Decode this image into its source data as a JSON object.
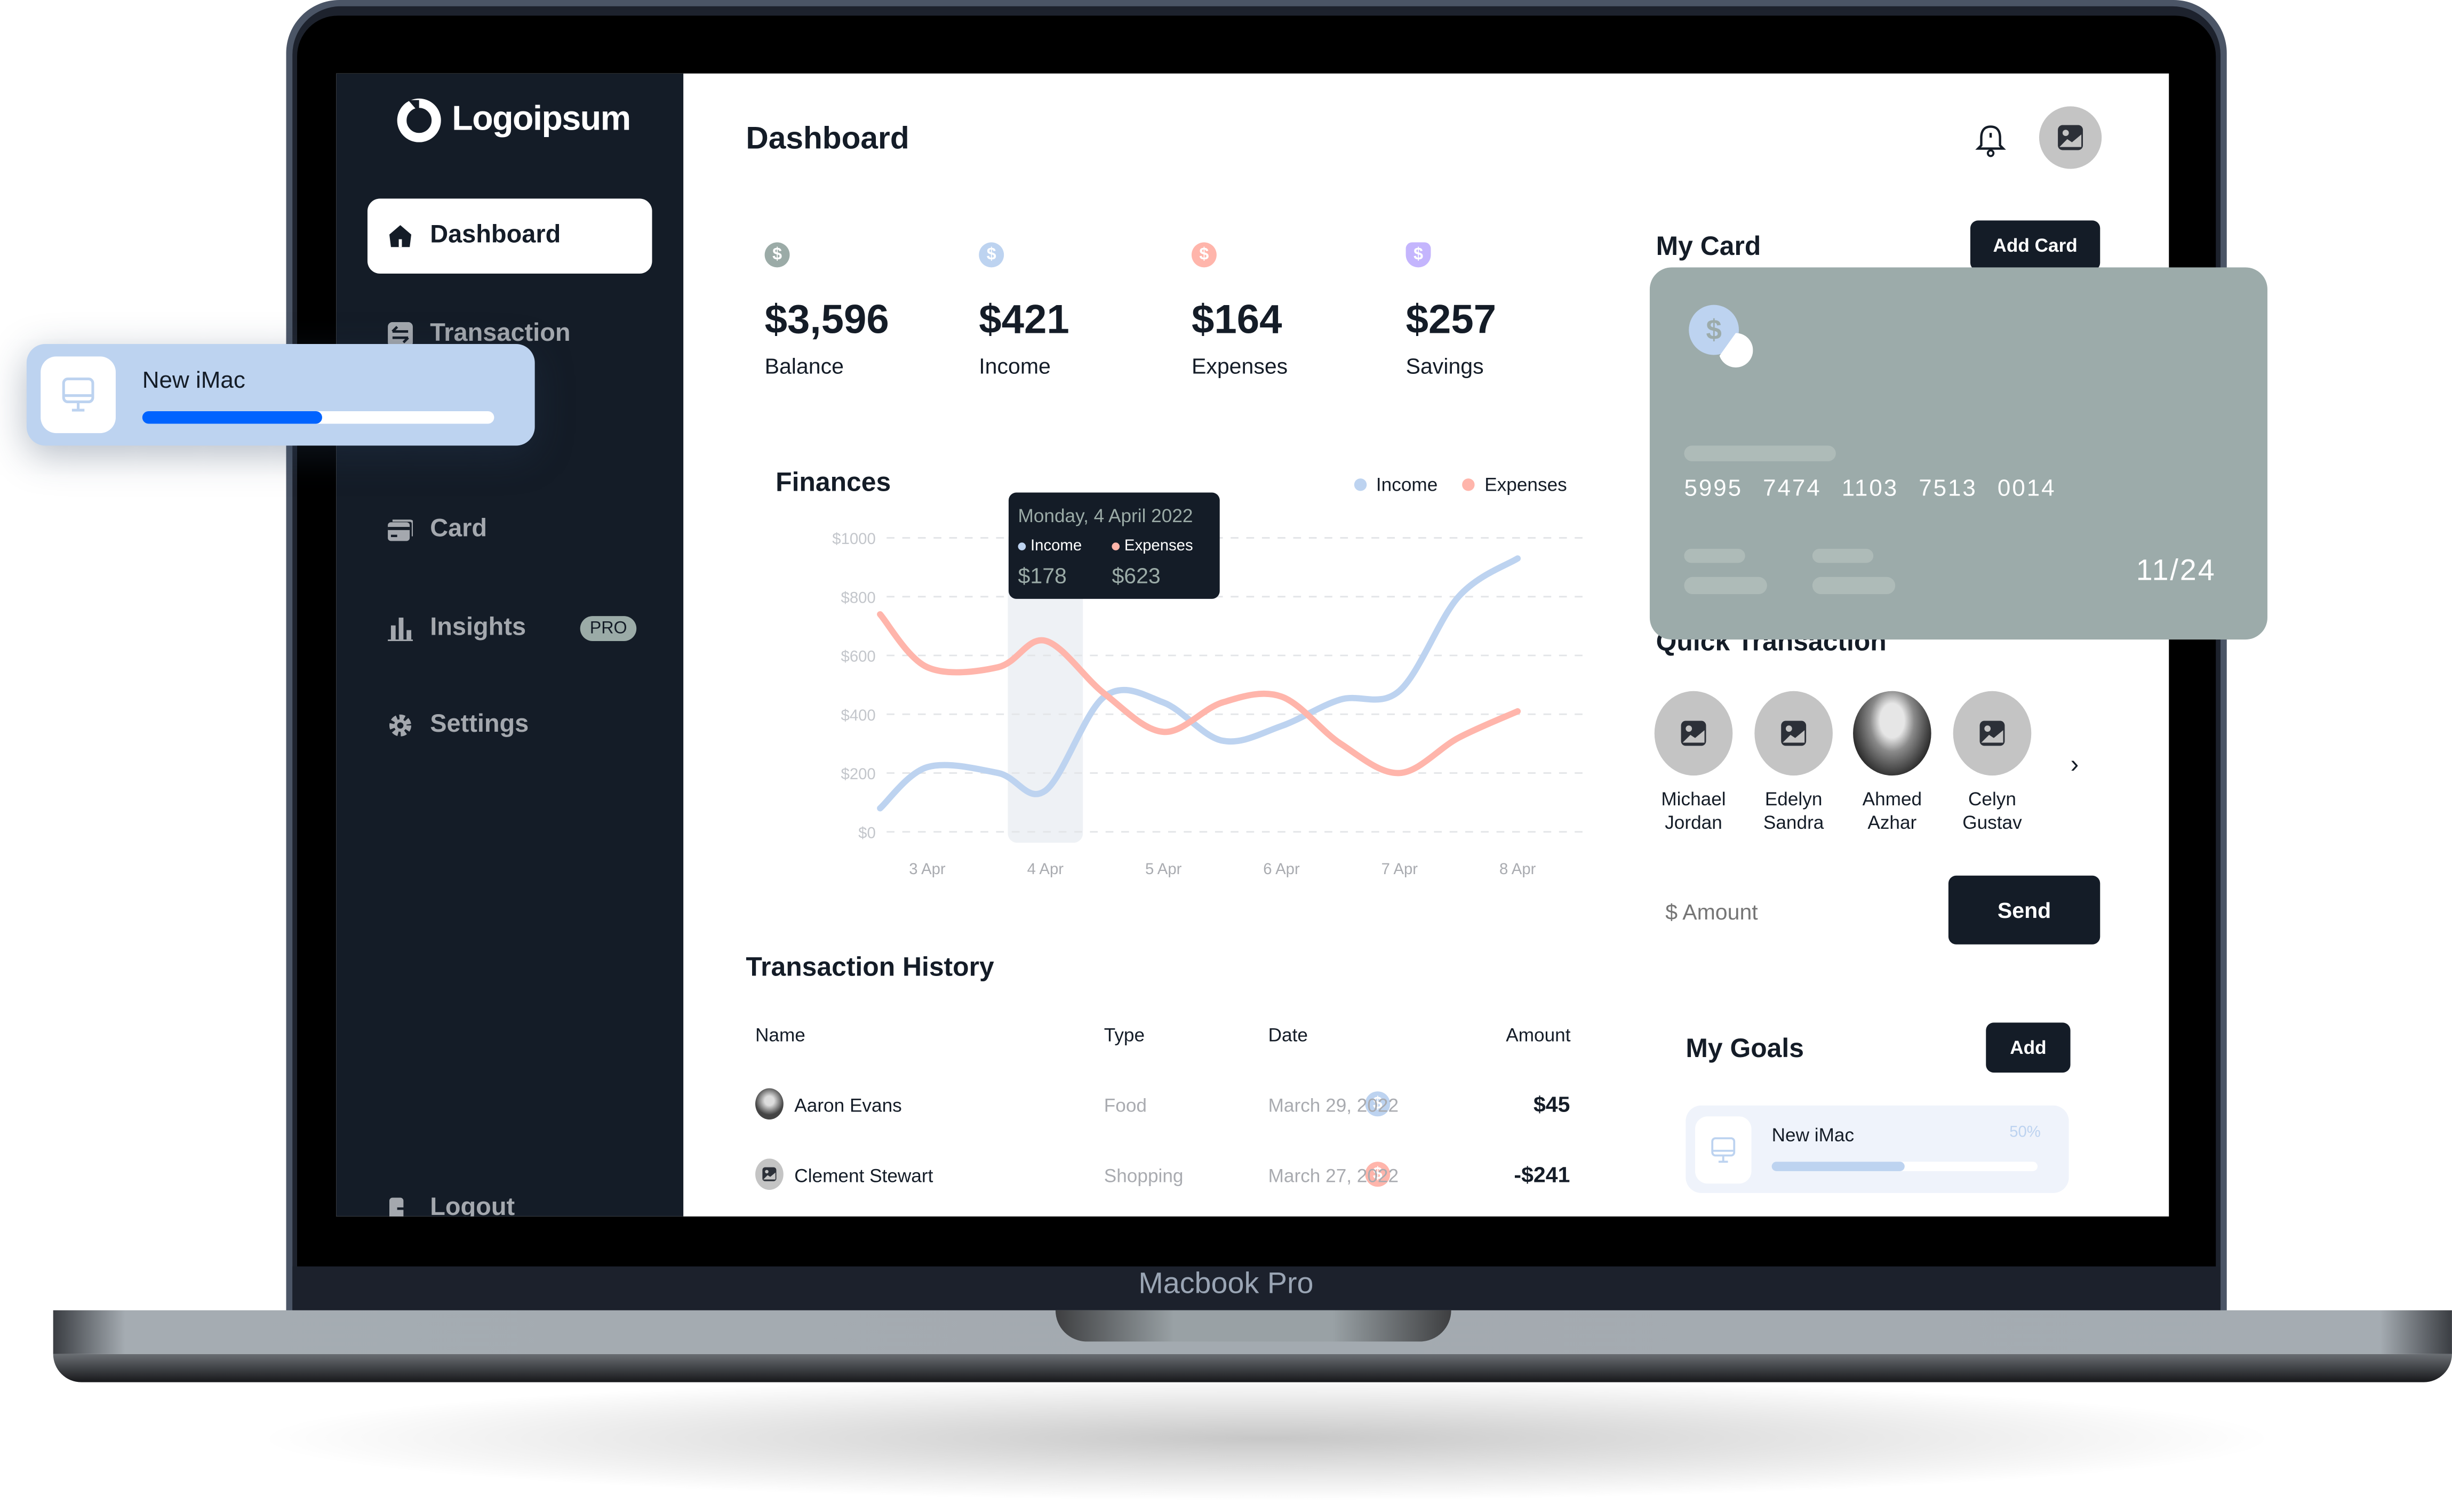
{
  "device": {
    "model_label": "Macbook Pro"
  },
  "brand": {
    "name": "Logoipsum"
  },
  "sidebar": {
    "items": [
      {
        "label": "Dashboard",
        "icon": "home-icon",
        "active": true
      },
      {
        "label": "Transaction",
        "icon": "transfer-icon",
        "active": false
      },
      {
        "label": "Card",
        "icon": "card-icon",
        "active": false
      },
      {
        "label": "Insights",
        "icon": "bar-chart-icon",
        "active": false,
        "badge": "PRO"
      },
      {
        "label": "Settings",
        "icon": "gear-icon",
        "active": false
      }
    ],
    "logout_label": "Logout"
  },
  "header": {
    "title": "Dashboard"
  },
  "stats": [
    {
      "value": "$3,596",
      "label": "Balance",
      "color": "#9baba7"
    },
    {
      "value": "$421",
      "label": "Income",
      "color": "#bdd3f0"
    },
    {
      "value": "$164",
      "label": "Expenses",
      "color": "#ffb5ab"
    },
    {
      "value": "$257",
      "label": "Savings",
      "color": "#c4b5fd"
    }
  ],
  "finances": {
    "title": "Finances",
    "legend": [
      {
        "label": "Income",
        "color": "#bdd3f0"
      },
      {
        "label": "Expenses",
        "color": "#ffb5ab"
      }
    ],
    "tooltip": {
      "date": "Monday, 4 April 2022",
      "income_label": "Income",
      "income_value": "$178",
      "expenses_label": "Expenses",
      "expenses_value": "$623"
    }
  },
  "chart_data": {
    "type": "line",
    "title": "Finances",
    "categories": [
      "3 Apr",
      "4 Apr",
      "5 Apr",
      "6 Apr",
      "7 Apr",
      "8 Apr"
    ],
    "x": [
      2.6,
      3,
      3.6,
      4,
      4.5,
      5,
      5.5,
      6,
      6.5,
      7,
      7.5,
      8
    ],
    "series": [
      {
        "name": "Income",
        "color": "#bdd3f0",
        "values": [
          80,
          220,
          200,
          140,
          460,
          440,
          310,
          360,
          450,
          480,
          800,
          930
        ]
      },
      {
        "name": "Expenses",
        "color": "#ffb5ab",
        "values": [
          740,
          560,
          560,
          650,
          470,
          340,
          440,
          460,
          300,
          200,
          320,
          410
        ]
      }
    ],
    "highlight_category": "4 Apr",
    "yticks": [
      "$0",
      "$200",
      "$400",
      "$600",
      "$800",
      "$1000"
    ],
    "ylim": [
      0,
      1000
    ],
    "grid": true,
    "legend_position": "top-right"
  },
  "transactions": {
    "title": "Transaction History",
    "columns": [
      "Name",
      "Type",
      "Date",
      "Amount"
    ],
    "rows": [
      {
        "name": "Aaron Evans",
        "type": "Food",
        "type_color": "#bdd3f0",
        "date": "March 29, 2022",
        "amount": "$45",
        "avatar": "photo"
      },
      {
        "name": "Clement Stewart",
        "type": "Shopping",
        "type_color": "#ffb5ab",
        "date": "March 27, 2022",
        "amount": "-$241",
        "avatar": "placeholder"
      }
    ]
  },
  "my_card": {
    "title": "My Card",
    "add_label": "Add Card",
    "number": [
      "5995",
      "7474",
      "1103",
      "7513",
      "0014"
    ],
    "expiry": "11/24"
  },
  "quick_transaction": {
    "title": "Quick Transaction",
    "people": [
      {
        "first": "Michael",
        "last": "Jordan",
        "avatar": "placeholder"
      },
      {
        "first": "Edelyn",
        "last": "Sandra",
        "avatar": "placeholder"
      },
      {
        "first": "Ahmed",
        "last": "Azhar",
        "avatar": "photo"
      },
      {
        "first": "Celyn",
        "last": "Gustav",
        "avatar": "placeholder"
      }
    ],
    "amount_placeholder": "$ Amount",
    "send_label": "Send"
  },
  "goals": {
    "title": "My Goals",
    "add_label": "Add",
    "items": [
      {
        "name": "New iMac",
        "percent_label": "50%",
        "progress": 0.5
      }
    ]
  },
  "floating_goal": {
    "name": "New iMac",
    "progress": 0.51
  }
}
